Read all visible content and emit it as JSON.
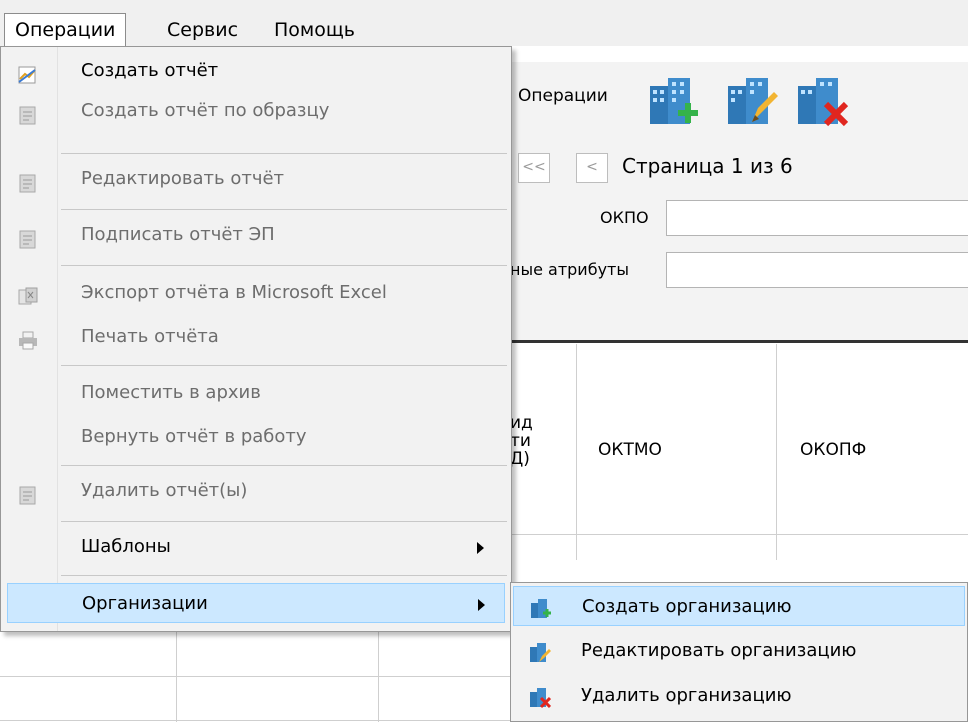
{
  "menubar": {
    "items": [
      {
        "label": "Операции",
        "open": true
      },
      {
        "label": "Сервис"
      },
      {
        "label": "Помощь"
      }
    ]
  },
  "toolbar": {
    "ops_label": "Операции",
    "buttons": [
      "building-add-icon",
      "building-edit-icon",
      "building-delete-icon"
    ]
  },
  "pager": {
    "first": "<<",
    "prev": "<",
    "text": "Страница 1 из 6"
  },
  "filters": {
    "okpo_label": "ОКПО",
    "okpo_value": "",
    "attrs_label": "ные атрибуты",
    "attrs_value": ""
  },
  "grid": {
    "partial_col_lines": [
      "ид",
      "ти",
      "Д)"
    ],
    "col_oktmo": "ОКТМО",
    "col_okopf": "ОКОПФ"
  },
  "menu": {
    "items": {
      "create": "Создать отчёт",
      "create_from": "Создать отчёт по образцу",
      "edit": "Редактировать отчёт",
      "sign": "Подписать отчёт ЭП",
      "export": "Экспорт отчёта в Microsoft Excel",
      "print": "Печать отчёта",
      "archive": "Поместить в архив",
      "return": "Вернуть отчёт в работу",
      "delete": "Удалить отчёт(ы)",
      "templates": "Шаблоны",
      "orgs": "Организации"
    }
  },
  "submenu": {
    "create": "Создать организацию",
    "edit": "Редактировать организацию",
    "delete": "Удалить организацию"
  },
  "colors": {
    "highlight": "#cce8ff",
    "highlight_border": "#99d1ff",
    "disabled_text": "#6d6d6d"
  }
}
